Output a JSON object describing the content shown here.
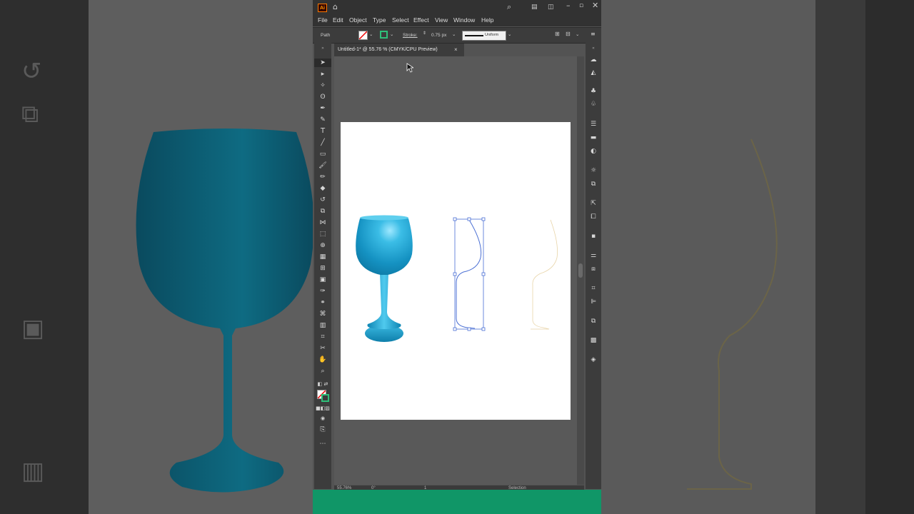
{
  "window": {
    "app_logo": "Ai",
    "icons": [
      "home-icon",
      "search-icon",
      "arrange-documents-icon",
      "workspace-switcher-icon",
      "minimize-icon",
      "maximize-icon",
      "close-icon"
    ]
  },
  "menu": [
    "File",
    "Edit",
    "Object",
    "Type",
    "Select",
    "Effect",
    "View",
    "Window",
    "Help"
  ],
  "control_bar": {
    "selection_type": "Path",
    "stroke_label": "Stroke:",
    "stroke_weight": "0.75 px",
    "profile_label": "Uniform"
  },
  "document_tab": {
    "title": "Untitled-1* @ 55.76 % (CMYK/CPU Preview)",
    "close": "×"
  },
  "status_bar": {
    "zoom": "55.76%",
    "rotation": "0°",
    "artboard_number": "1",
    "tool_name": "Selection"
  },
  "colors": {
    "accent_green": "#109667",
    "glass_blue": "#1a9cc8",
    "path_blue": "#4a6fd4",
    "ghost_tan": "#e8d4a8"
  }
}
